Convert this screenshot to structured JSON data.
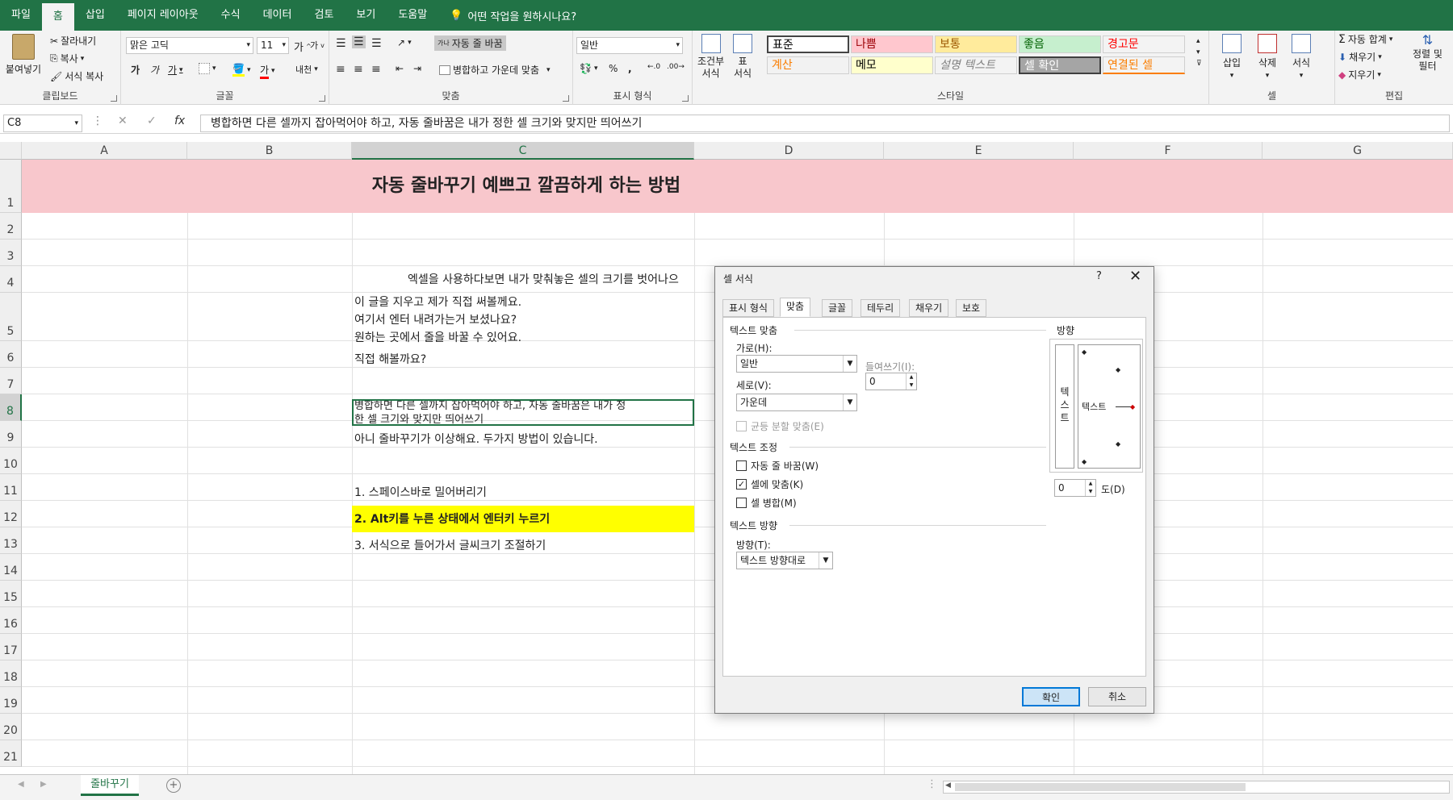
{
  "menubar": {
    "tabs": [
      "파일",
      "홈",
      "삽입",
      "페이지 레이아웃",
      "수식",
      "데이터",
      "검토",
      "보기",
      "도움말"
    ],
    "active": "홈",
    "tellme": "어떤 작업을 원하시나요?"
  },
  "ribbon": {
    "clipboard": {
      "paste": "붙여넣기",
      "cut": "잘라내기",
      "copy": "복사",
      "format_painter": "서식 복사",
      "label": "클립보드"
    },
    "font": {
      "name": "맑은 고딕",
      "size": "11",
      "label": "글꼴",
      "bold": "가",
      "italic": "가",
      "underline": "가",
      "grow": "가",
      "shrink": "가",
      "phonetic": "내천",
      "fontcolor": "가"
    },
    "alignment": {
      "wrap": "자동 줄 바꿈",
      "merge": "병합하고 가운데 맞춤",
      "label": "맞춤",
      "wrap_icon": "가나"
    },
    "number": {
      "format": "일반",
      "label": "표시 형식",
      "percent": "%",
      "comma": ","
    },
    "styles": {
      "conditional": "조건부\n서식",
      "table": "표\n서식",
      "label": "스타일",
      "cells": [
        {
          "text": "표준",
          "bg": "#ffffff",
          "color": "#000000"
        },
        {
          "text": "나쁨",
          "bg": "#ffc7ce",
          "color": "#9c0006"
        },
        {
          "text": "보통",
          "bg": "#ffeb9c",
          "color": "#9c5700"
        },
        {
          "text": "좋음",
          "bg": "#c6efce",
          "color": "#006100"
        },
        {
          "text": "경고문",
          "bg": "#f3f3f3",
          "color": "#ff0000"
        },
        {
          "text": "계산",
          "bg": "#f2f2f2",
          "color": "#fa7d00"
        },
        {
          "text": "메모",
          "bg": "#ffffcc",
          "color": "#000000"
        },
        {
          "text": "설명 텍스트",
          "bg": "#f3f3f3",
          "color": "#7f7f7f"
        },
        {
          "text": "셀 확인",
          "bg": "#a5a5a5",
          "color": "#ffffff"
        },
        {
          "text": "연결된 셀",
          "bg": "#f3f3f3",
          "color": "#fa7d00"
        }
      ]
    },
    "cells": {
      "insert": "삽입",
      "delete": "삭제",
      "format": "서식",
      "label": "셀"
    },
    "editing": {
      "autosum": "자동 합계",
      "fill": "채우기",
      "clear": "지우기",
      "sort": "정렬 및\n필터",
      "label": "편집"
    }
  },
  "formula_bar": {
    "name_box": "C8",
    "fx": "fx",
    "content": "병합하면 다른 셀까지 잡아먹어야 하고, 자동 줄바꿈은 내가 정한 셀 크기와 맞지만 띄어쓰기"
  },
  "sheet": {
    "columns": [
      "A",
      "B",
      "C",
      "D",
      "E",
      "F",
      "G"
    ],
    "rows": [
      "1",
      "2",
      "3",
      "4",
      "5",
      "6",
      "7",
      "8",
      "9",
      "10",
      "11",
      "12",
      "13",
      "14",
      "15",
      "16",
      "17",
      "18",
      "19",
      "20",
      "21"
    ],
    "title": "자동 줄바꾸기 예쁘고 깔끔하게 하는 방법",
    "r4": "엑셀을 사용하다보면 내가 맞춰놓은 셀의 크기를 벗어나으",
    "r5a": "이 글을 지우고 제가 직접 써볼께요.",
    "r5b": "여기서 엔터 내려가는거 보셨나요?",
    "r5c": "원하는 곳에서 줄을 바꿀 수 있어요.",
    "r6": "직접 해볼까요?",
    "r8a": "병합하면 다른 셀까지 잡아먹어야 하고, 자동 줄바꿈은 내가 정",
    "r8b": "한 셀 크기와 맞지만 띄어쓰기",
    "r9": "아니 줄바꾸기가 이상해요. 두가지 방법이 있습니다.",
    "r11": "1. 스페이스바로 밀어버리기",
    "r12": "2. Alt키를 누른 상태에서 엔터키 누르기",
    "r13": "3. 서식으로 들어가서 글씨크기 조절하기",
    "tab": "줄바꾸기"
  },
  "dialog": {
    "title": "셀 서식",
    "help": "?",
    "tabs": [
      "표시 형식",
      "맞춤",
      "글꼴",
      "테두리",
      "채우기",
      "보호"
    ],
    "active_tab": "맞춤",
    "text_align": "텍스트 맞춤",
    "horizontal_label": "가로(H):",
    "horizontal_value": "일반",
    "indent_label": "들여쓰기(I):",
    "indent_value": "0",
    "vertical_label": "세로(V):",
    "vertical_value": "가운데",
    "justify_distributed": "균등 분할 맞춤(E)",
    "text_control": "텍스트 조정",
    "wrap_text": "자동 줄 바꿈(W)",
    "shrink_to_fit": "셀에 맞춤(K)",
    "merge_cells": "셀 병합(M)",
    "shrink_checked": "✓",
    "rtl": "텍스트 방향",
    "direction_label": "방향(T):",
    "direction_value": "텍스트 방향대로",
    "orientation": "방향",
    "orient_vertical": "텍\n스\n트",
    "orient_text": "텍스트",
    "degrees_value": "0",
    "degrees_label": "도(D)",
    "ok": "확인",
    "cancel": "취소"
  }
}
